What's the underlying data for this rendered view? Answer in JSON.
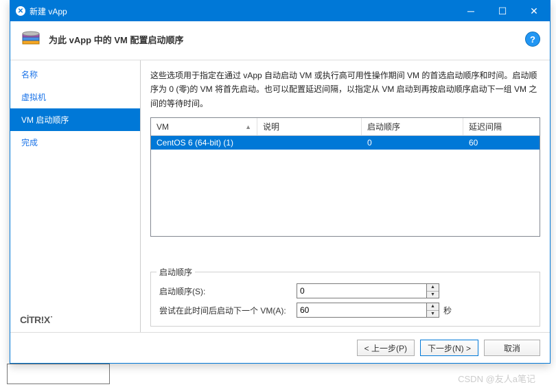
{
  "titlebar": {
    "title": "新建 vApp"
  },
  "header": {
    "title": "为此 vApp 中的 VM 配置启动顺序"
  },
  "sidebar": {
    "steps": [
      {
        "label": "名称"
      },
      {
        "label": "虚拟机"
      },
      {
        "label": "VM 启动顺序"
      },
      {
        "label": "完成"
      }
    ],
    "logo_prefix": "CİTR",
    "logo_suffix": "X"
  },
  "main": {
    "description": "这些选项用于指定在通过 vApp 自动启动 VM 或执行高可用性操作期间 VM 的首选启动顺序和时间。启动顺序为 0 (零)的 VM 将首先启动。也可以配置延迟间隔，以指定从 VM 启动到再按启动顺序启动下一组 VM 之间的等待时间。",
    "columns": {
      "vm": "VM",
      "desc": "说明",
      "order": "启动顺序",
      "delay": "延迟间隔"
    },
    "rows": [
      {
        "vm": "CentOS 6 (64-bit) (1)",
        "desc": "",
        "order": "0",
        "delay": "60"
      }
    ],
    "fieldset": {
      "legend": "启动顺序",
      "order_label": "启动顺序(S):",
      "order_value": "0",
      "attempt_label": "尝试在此时间后启动下一个 VM(A):",
      "attempt_value": "60",
      "unit": "秒"
    }
  },
  "footer": {
    "prev": "< 上一步(P)",
    "next": "下一步(N) >",
    "cancel": "取消"
  },
  "watermark": "CSDN @友人a笔记",
  "chart_data": null
}
